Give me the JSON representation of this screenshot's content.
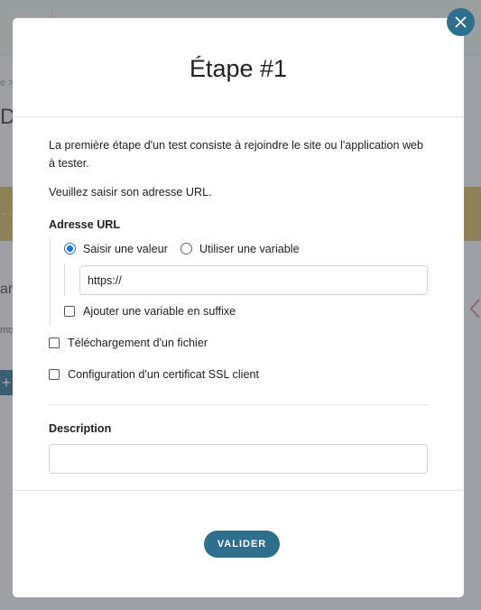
{
  "background": {
    "breadcrumb": "e >",
    "title": "De",
    "band_text": "- ·",
    "subtitle": "ar",
    "small_text": "mo",
    "plus": "+"
  },
  "modal": {
    "title": "Étape #1",
    "intro_line": "La première étape d'un test consiste à rejoindre le site ou l'application web à tester.",
    "intro_url": "Veuillez saisir son adresse URL.",
    "url_section": {
      "label": "Adresse URL",
      "radio_value": "Saisir une valeur",
      "radio_variable": "Utiliser une variable",
      "selected": "Saisir une valeur",
      "input_value": "https://",
      "suffix_checkbox": "Ajouter une variable en suffixe"
    },
    "file_download_checkbox": "Téléchargement d'un fichier",
    "ssl_checkbox": "Configuration d'un certificat SSL client",
    "description_label": "Description",
    "description_value": "",
    "submit_label": "VALIDER"
  },
  "colors": {
    "accent": "#2f6f8e",
    "radio_selected": "#1a73e8",
    "band": "#d6b25a"
  }
}
